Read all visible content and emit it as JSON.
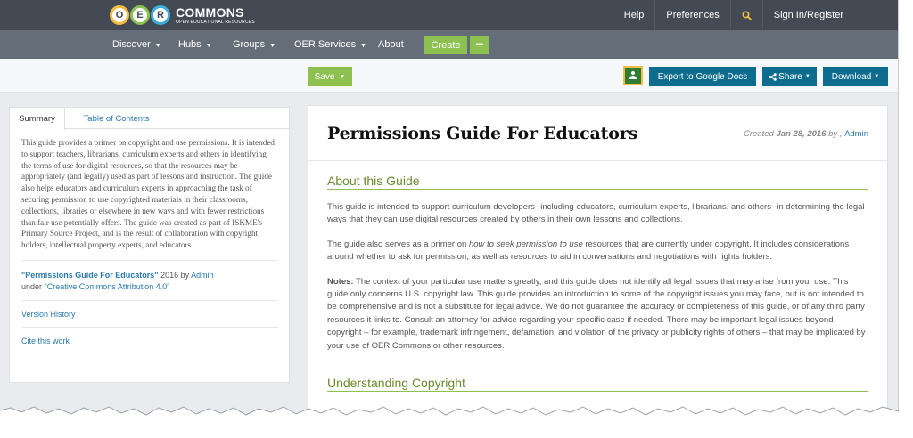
{
  "logo": {
    "letters": [
      "O",
      "E",
      "R"
    ],
    "name": "COMMONS",
    "tagline": "OPEN EDUCATIONAL RESOURCES"
  },
  "topnav": {
    "help": "Help",
    "preferences": "Preferences",
    "search_icon": "search-icon",
    "signin": "Sign In/Register"
  },
  "mainnav": {
    "discover": "Discover",
    "hubs": "Hubs",
    "groups": "Groups",
    "oer_services": "OER Services",
    "about": "About",
    "create": "Create",
    "more": "▪▪▪"
  },
  "actions": {
    "save": "Save",
    "export": "Export to Google Docs",
    "share": "Share",
    "download": "Download"
  },
  "sidebar": {
    "tabs": [
      "Summary",
      "Table of Contents"
    ],
    "summary": "This guide provides a primer on copyright and use permissions. It is intended to support teachers, librarians, curriculum experts and others in identifying the terms of use for digital resources, so that the resources may be appropriately (and legally) used as part of lessons and instruction. The guide also helps educators and curriculum experts in approaching the task of securing permission to use copyrighted materials in their classrooms, collections, libraries or elsewhere in new ways and with fewer restrictions than fair use potentially offers. The guide was created as part of ISKME's Primary Source Project, and is the result of collaboration with copyright holders, intellectual property experts, and educators.",
    "attrib_title": "\"Permissions Guide For Educators\"",
    "attrib_year_by": " 2016 by ",
    "attrib_author": "Admin",
    "attrib_under": "under ",
    "attrib_license": "\"Creative Commons Attribution 4.0\"",
    "version_history": "Version History",
    "cite": "Cite this work"
  },
  "doc": {
    "title": "Permissions Guide For Educators",
    "created_label": "Created",
    "created_date": "Jan 28, 2016",
    "created_by": "by ,",
    "author": "Admin",
    "section1": "About this Guide",
    "p1": "This guide is intended to support curriculum developers--including educators, curriculum experts, librarians, and others--in determining the legal ways that they can use digital resources created by others in their own lessons and collections.",
    "p2_a": "The guide also serves as a primer on ",
    "p2_em": "how to seek permission to use",
    "p2_b": " resources that are currently under copyright. It includes considerations around whether to ask for permission, as well as resources to aid in conversations and negotiations with rights holders.",
    "p3_label": "Notes:",
    "p3": " The context of your particular use matters greatly, and this guide does not identify all legal issues that may arise from your use. This guide only concerns U.S. copyright law. This guide provides an introduction to some of the copyright issues you may face, but is not intended to be comprehensive and is not a substitute for legal advice. We do not guarantee the accuracy or completeness of this guide, or of any third party resources it links to. Consult an attorney for advice regarding your specific case if needed. There may be important legal issues beyond copyright – for example, trademark infringement, defamation, and violation of the privacy or publicity rights of others – that may be implicated by your use of OER Commons or other resources.",
    "section2": "Understanding Copyright"
  },
  "colors": {
    "topbar": "#434a54",
    "mainnav": "#656d78",
    "green": "#8cc152",
    "teal": "#0e6d8e",
    "link": "#2a7ab0"
  }
}
